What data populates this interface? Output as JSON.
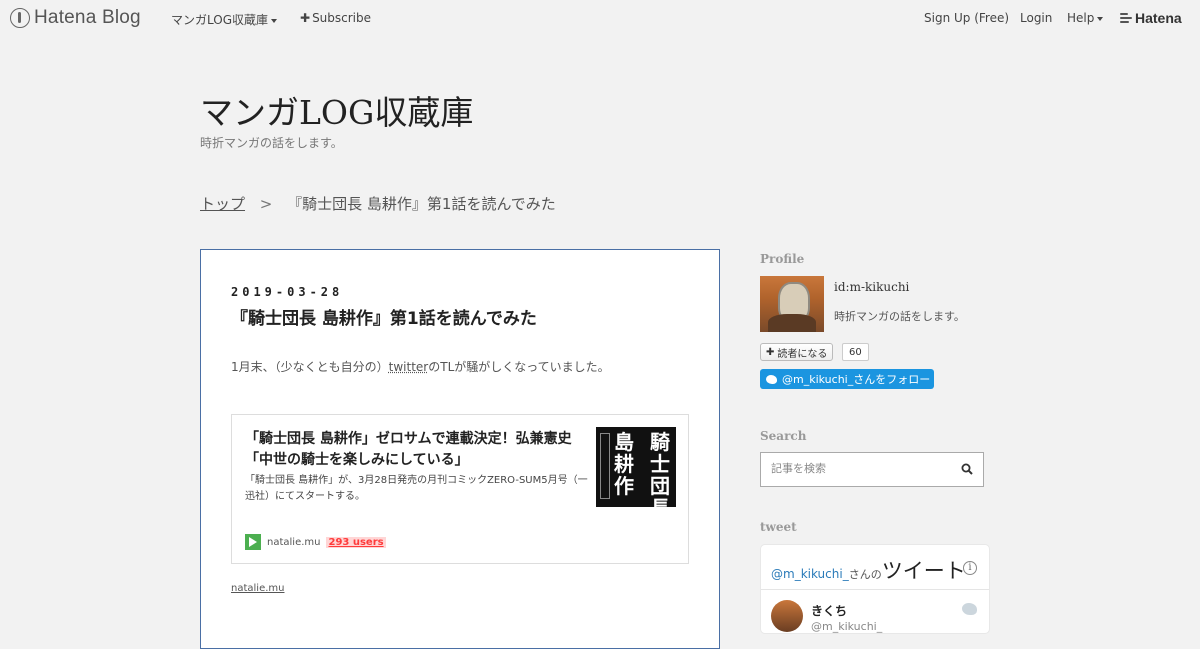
{
  "topbar": {
    "logo_text": "Hatena Blog",
    "blog_menu": "マンガLOG収蔵庫",
    "subscribe": "Subscribe",
    "signup": "Sign Up (Free)",
    "login": "Login",
    "help": "Help",
    "brand": "Hatena"
  },
  "header": {
    "title": "マンガLOG収蔵庫",
    "description": "時折マンガの話をします。"
  },
  "breadcrumb": {
    "top": "トップ",
    "separator": ">",
    "current": "『騎士団長 島耕作』第1話を読んでみた"
  },
  "article": {
    "date": "2019-03-28",
    "title": "『騎士団長 島耕作』第1話を読んでみた",
    "body_before": "1月末、（少なくとも自分の）",
    "body_link": "twitter",
    "body_after": "のTLが騒がしくなっていました。",
    "embed": {
      "title": "「騎士団長 島耕作」ゼロサムで連載決定！弘兼憲史「中世の騎士を楽しみにしている」",
      "description": "「騎士団長 島耕作」が、3月28日発売の月刊コミックZERO-SUM5月号（一迅社）にてスタートする。",
      "site": "natalie.mu",
      "users": "293 users",
      "thumb_text_1": "騎士団長",
      "thumb_text_2": "島耕作"
    },
    "source_link": "natalie.mu"
  },
  "sidebar": {
    "profile_heading": "Profile",
    "profile_id": "id:m-kikuchi",
    "profile_desc": "時折マンガの話をします。",
    "reader_button": "読者になる",
    "reader_count": "60",
    "follow_button": "@m_kikuchi_さんをフォロー",
    "search_heading": "Search",
    "search_placeholder": "記事を検索",
    "tweet_heading": "tweet",
    "tweet_handle": "@m_kikuchi_",
    "tweet_san": "さんの",
    "tweet_label": "ツイート",
    "tweet_name": "きくち",
    "tweet_user": "@m_kikuchi_"
  },
  "icons": {
    "logo": "hatena-blog-logo-icon",
    "search": "search-icon",
    "bird": "twitter-bird-icon",
    "info": "info-icon",
    "favicon": "site-favicon-icon"
  },
  "colors": {
    "background": "#f2f2f2",
    "article_border": "#4a6fa5",
    "twitter_blue": "#1b95e0",
    "users_red": "#ff3b3b"
  }
}
